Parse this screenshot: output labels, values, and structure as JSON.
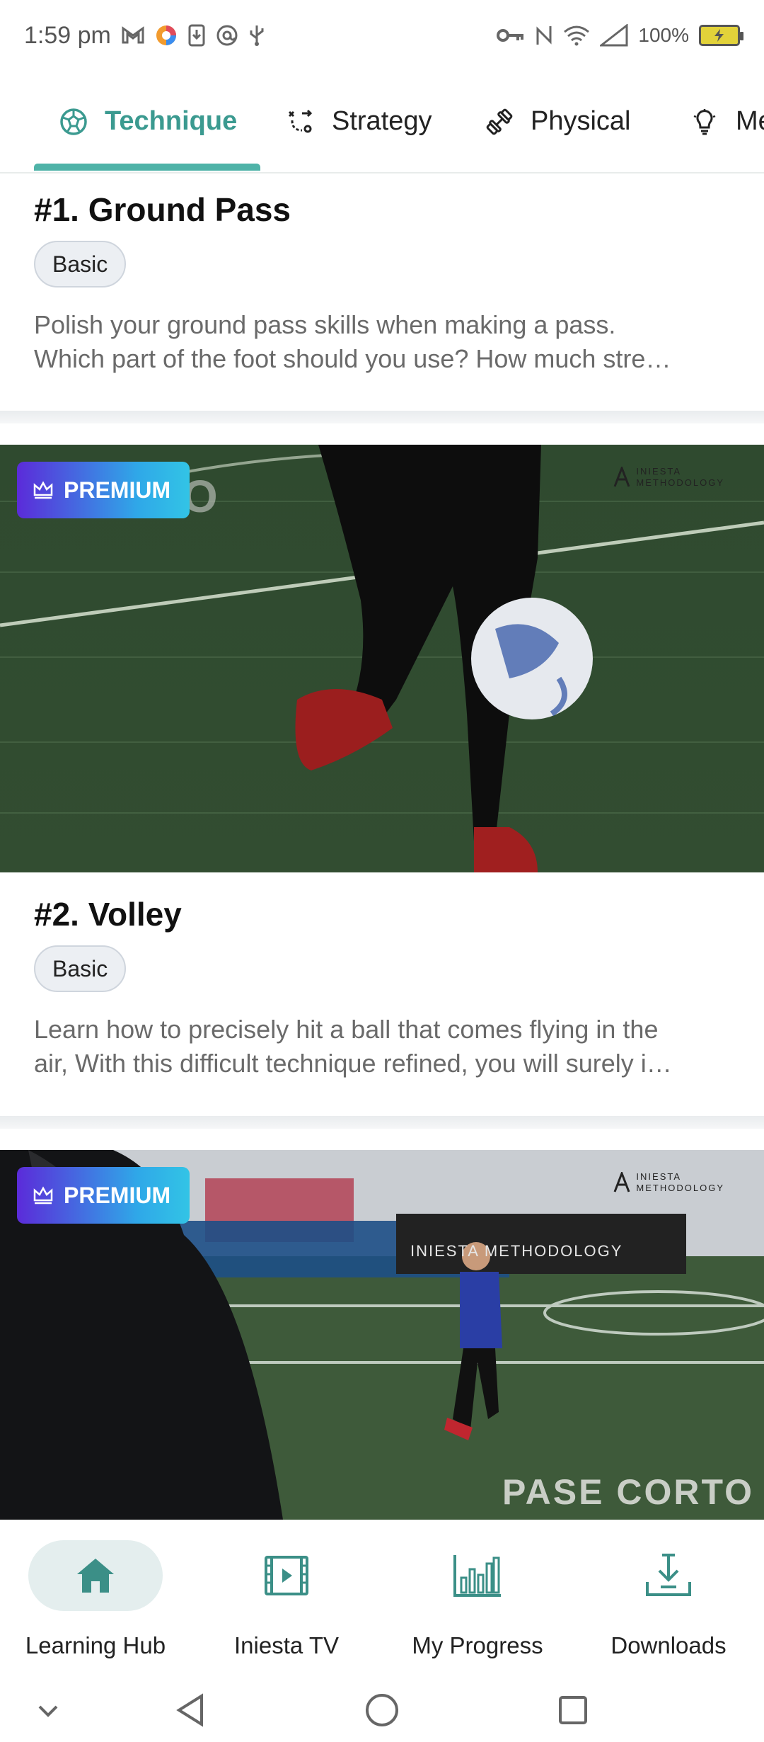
{
  "status_bar": {
    "time": "1:59 pm",
    "battery_percent": "100%"
  },
  "tabs": [
    {
      "label": "Technique",
      "icon": "soccer-ball-icon",
      "active": true
    },
    {
      "label": "Strategy",
      "icon": "tactics-icon",
      "active": false
    },
    {
      "label": "Physical",
      "icon": "dumbbell-icon",
      "active": false
    },
    {
      "label": "Me",
      "icon": "lightbulb-icon",
      "active": false
    }
  ],
  "lessons": [
    {
      "title": "#1. Ground Pass",
      "level": "Basic",
      "desc_line1": "Polish your ground pass skills when making a pass.",
      "desc_line2": "Which part of the foot should you use? How much stre…"
    },
    {
      "badge": "PREMIUM",
      "watermark": "INIESTA METHODOLOGY",
      "overlay_text": "AEREO",
      "title": "#2. Volley",
      "level": "Basic",
      "desc_line1": "Learn how to precisely hit a ball that comes flying  in the",
      "desc_line2": "air, With this difficult technique refined, you will surely i…"
    },
    {
      "badge": "PREMIUM",
      "watermark": "INIESTA METHODOLOGY",
      "banner_text": "INIESTA METHODOLOGY",
      "overlay_text": "PASE CORTO"
    }
  ],
  "bottom_nav": [
    {
      "label": "Learning Hub",
      "icon": "home-icon",
      "active": true
    },
    {
      "label": "Iniesta TV",
      "icon": "video-icon",
      "active": false
    },
    {
      "label": "My Progress",
      "icon": "bar-chart-icon",
      "active": false
    },
    {
      "label": "Downloads",
      "icon": "download-icon",
      "active": false
    }
  ],
  "colors": {
    "accent": "#3b9a90",
    "premium_start": "#5b2bd9",
    "premium_end": "#32c4e6"
  }
}
